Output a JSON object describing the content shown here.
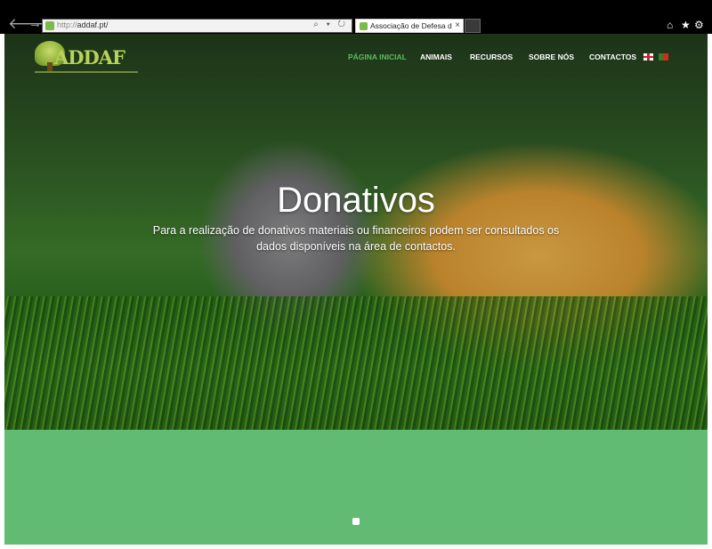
{
  "browser": {
    "url_prefix": "http://",
    "url_host": "addaf.pt/",
    "address_tools": "⌕ ▾ ↻",
    "tab_title": "Associação de Defesa dos D...",
    "tab_close": "×",
    "icons": [
      "back-icon",
      "forward-icon",
      "home-icon",
      "star-icon",
      "gear-icon"
    ]
  },
  "site": {
    "logo_text": "ADDAF",
    "menu": [
      "PÁGINA INICIAL",
      "ANIMAIS",
      "RECURSOS",
      "SOBRE NÓS",
      "CONTACTOS"
    ],
    "active_menu_color": "#5dbb62",
    "languages": [
      "en-flag",
      "pt-flag"
    ]
  },
  "hero": {
    "title": "Donativos",
    "text": "Para a realização de donativos materiais ou financeiros podem ser consultados os dados disponíveis na área de contactos."
  },
  "footer_band": {
    "color": "#62bb72"
  }
}
